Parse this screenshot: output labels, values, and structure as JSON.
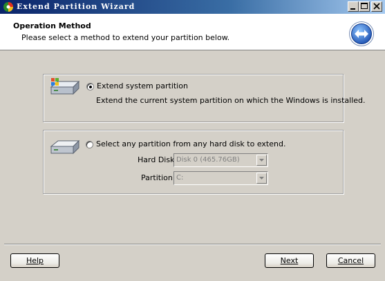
{
  "window": {
    "title": "Extend Partition Wizard",
    "app_icon": "partition-wizard-logo-icon"
  },
  "window_controls": [
    "minimize-icon",
    "maximize-icon",
    "close-icon"
  ],
  "header": {
    "title": "Operation Method",
    "subtitle": "Please select a method to extend your partition below.",
    "icon": "extend-arrows-icon"
  },
  "option_system": {
    "label": "Extend system partition",
    "description": "Extend the current system partition on which the Windows is installed.",
    "selected": true,
    "icon": "windows-disk-icon"
  },
  "option_any": {
    "label": "Select any partition from any hard disk to extend.",
    "selected": false,
    "icon": "hard-disk-icon",
    "hard_disk_label": "Hard Disk",
    "hard_disk_value": "Disk 0 (465.76GB)",
    "partition_label": "Partition",
    "partition_value": "C:"
  },
  "buttons": {
    "help": "Help",
    "next": "Next",
    "cancel": "Cancel"
  }
}
